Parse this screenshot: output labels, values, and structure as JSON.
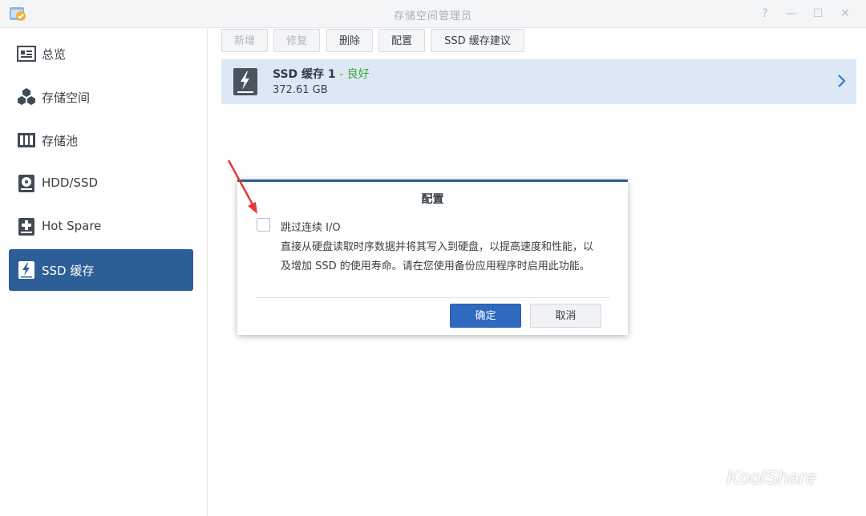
{
  "window": {
    "title": "存储空间管理员",
    "controls": [
      "?",
      "—",
      "☐",
      "✕"
    ]
  },
  "sidebar": {
    "items": [
      {
        "label": "总览",
        "icon": "overview-icon"
      },
      {
        "label": "存储空间",
        "icon": "cubes-icon"
      },
      {
        "label": "存储池",
        "icon": "storage-pool-icon"
      },
      {
        "label": "HDD/SSD",
        "icon": "disk-icon"
      },
      {
        "label": "Hot Spare",
        "icon": "hot-spare-icon"
      },
      {
        "label": "SSD 缓存",
        "icon": "ssd-cache-icon",
        "active": true
      }
    ]
  },
  "toolbar": {
    "create": "新增",
    "repair": "修复",
    "delete": "删除",
    "configure": "配置",
    "ssd_advisor": "SSD 缓存建议"
  },
  "cache": {
    "name": "SSD 缓存 1",
    "separator": " - ",
    "status": "良好",
    "size": "372.61 GB",
    "status_color": "#3ea53e"
  },
  "dialog": {
    "title": "配置",
    "checkbox_label": "跳过连续 I/O",
    "description_line1": "直接从硬盘读取时序数据并将其写入到硬盘，以提高速度和性能，以",
    "description_line2": "及增加 SSD 的使用寿命。请在您使用备份应用程序时启用此功能。",
    "ok": "确定",
    "cancel": "取消"
  },
  "colors": {
    "accent": "#2d5e97",
    "primary_button": "#2e6ac0",
    "selected_row": "#dde8f5"
  },
  "watermark": {
    "text": "KoolShare"
  }
}
